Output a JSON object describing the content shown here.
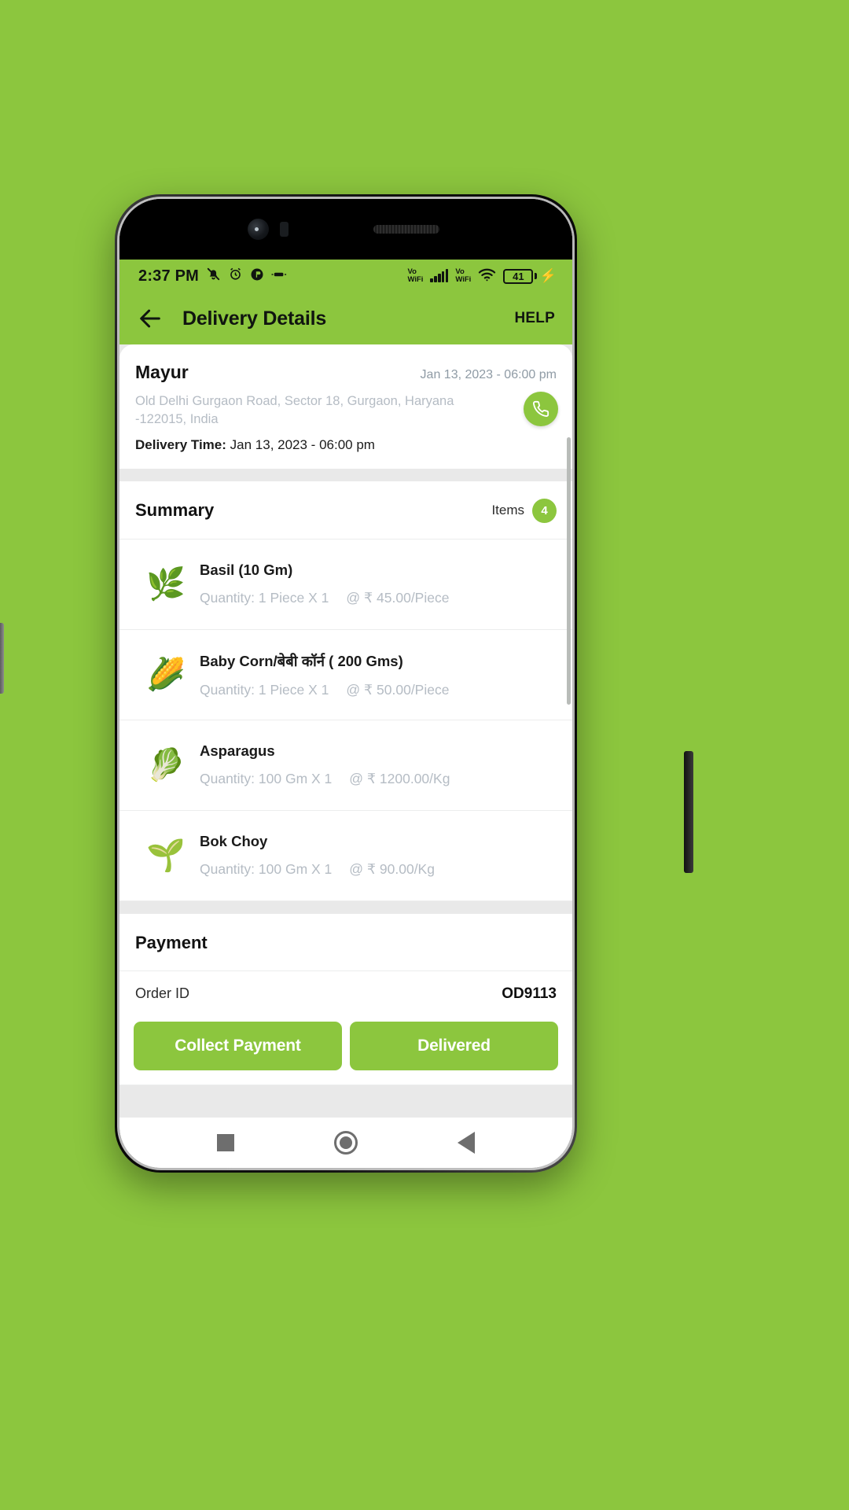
{
  "theme": {
    "brand_green": "#8CC63E",
    "page_background": "#8CC63E",
    "muted_text": "#b5bcc4"
  },
  "statusbar": {
    "time": "2:37 PM",
    "icons_left": [
      "silent-bell-icon",
      "alarm-icon",
      "dnd-icon",
      "vibrate-icon"
    ],
    "vowifi_1": "Vo",
    "vowifi_2": "WiFi",
    "vowifi_3": "Vo",
    "vowifi_4": "WiFi",
    "signal_icon": "signal-bars-icon",
    "wifi_icon": "wifi-icon",
    "battery_percent": "41",
    "charging_icon": "charging-bolt-icon"
  },
  "appbar": {
    "back_icon": "back-arrow-icon",
    "title": "Delivery Details",
    "help_label": "HELP"
  },
  "customer": {
    "name": "Mayur",
    "order_datetime": "Jan 13, 2023 - 06:00 pm",
    "address": "Old Delhi Gurgaon Road, Sector 18, Gurgaon, Haryana -122015, India",
    "delivery_time_label": "Delivery Time:",
    "delivery_time_value": "Jan 13, 2023 - 06:00 pm",
    "call_icon": "phone-call-icon"
  },
  "summary": {
    "title": "Summary",
    "items_label": "Items",
    "items_count": "4",
    "items": [
      {
        "name": "Basil (10 Gm)",
        "quantity": "Quantity: 1 Piece X 1",
        "rate": "@ ₹ 45.00/Piece",
        "thumb": "🌿"
      },
      {
        "name": "Baby Corn/बेबी कॉर्न ( 200 Gms)",
        "quantity": "Quantity: 1 Piece X 1",
        "rate": "@ ₹ 50.00/Piece",
        "thumb": "🌽"
      },
      {
        "name": "Asparagus",
        "quantity": "Quantity: 100 Gm X 1",
        "rate": "@ ₹ 1200.00/Kg",
        "thumb": "🥬"
      },
      {
        "name": "Bok Choy",
        "quantity": "Quantity: 100 Gm X 1",
        "rate": "@ ₹ 90.00/Kg",
        "thumb": "🌱"
      }
    ]
  },
  "payment": {
    "title": "Payment",
    "order_id_label": "Order ID",
    "order_id_value": "OD9113",
    "collect_payment_label": "Collect Payment",
    "delivered_label": "Delivered"
  },
  "navbar": {
    "recent_icon": "recents-square-icon",
    "home_icon": "home-circle-icon",
    "back_icon": "back-triangle-icon"
  }
}
